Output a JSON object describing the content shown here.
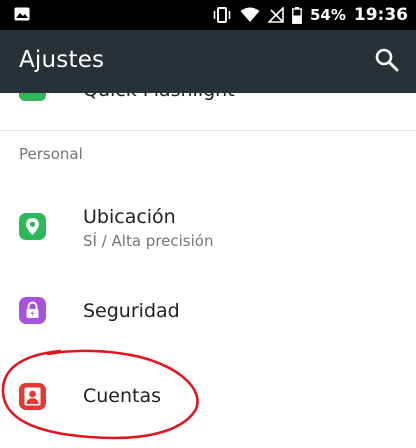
{
  "status_bar": {
    "battery_percent": "54%",
    "time": "19:36",
    "icons": [
      "gallery-icon",
      "vibrate-icon",
      "wifi-icon",
      "no-sim-icon",
      "battery-icon"
    ]
  },
  "toolbar": {
    "title": "Ajustes",
    "search_icon": "search-icon"
  },
  "partial_item": {
    "label": "Quick Flashlight"
  },
  "section": {
    "header": "Personal"
  },
  "items": [
    {
      "label": "Ubicación",
      "summary": "SÍ / Alta precisión",
      "icon": "location-icon",
      "icon_color": "#2fb85a"
    },
    {
      "label": "Seguridad",
      "icon": "lock-icon",
      "icon_color": "#a653e0"
    },
    {
      "label": "Cuentas",
      "icon": "account-icon",
      "icon_color": "#e53935"
    }
  ],
  "colors": {
    "toolbar": "#263238",
    "status_bar": "#000000",
    "annotation": "#e0151e"
  }
}
